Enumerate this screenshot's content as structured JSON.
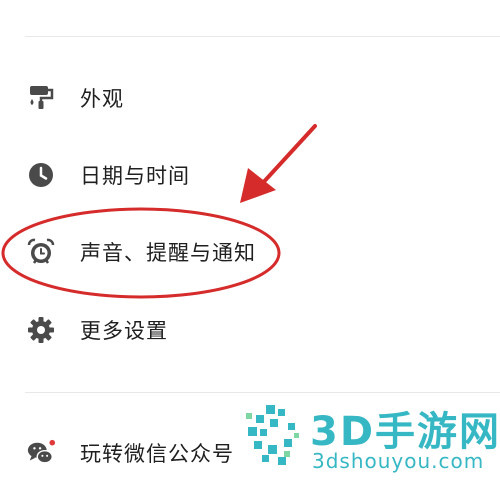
{
  "menu": {
    "items": [
      {
        "label": "外观",
        "icon": "paint-roller-icon"
      },
      {
        "label": "日期与时间",
        "icon": "clock-icon"
      },
      {
        "label": "声音、提醒与通知",
        "icon": "alarm-clock-icon"
      },
      {
        "label": "更多设置",
        "icon": "gear-icon"
      }
    ],
    "wechat": {
      "label": "玩转微信公众号",
      "icon": "wechat-icon",
      "has_badge": true
    }
  },
  "annotation": {
    "color": "#d62b2b"
  },
  "watermark": {
    "title": "3D手游网",
    "url": "3dshouyou.com",
    "color": "#36b7c4"
  },
  "colors": {
    "icon": "#4a4a4a",
    "text": "#1f1f1f",
    "badge": "#e03b3b"
  }
}
